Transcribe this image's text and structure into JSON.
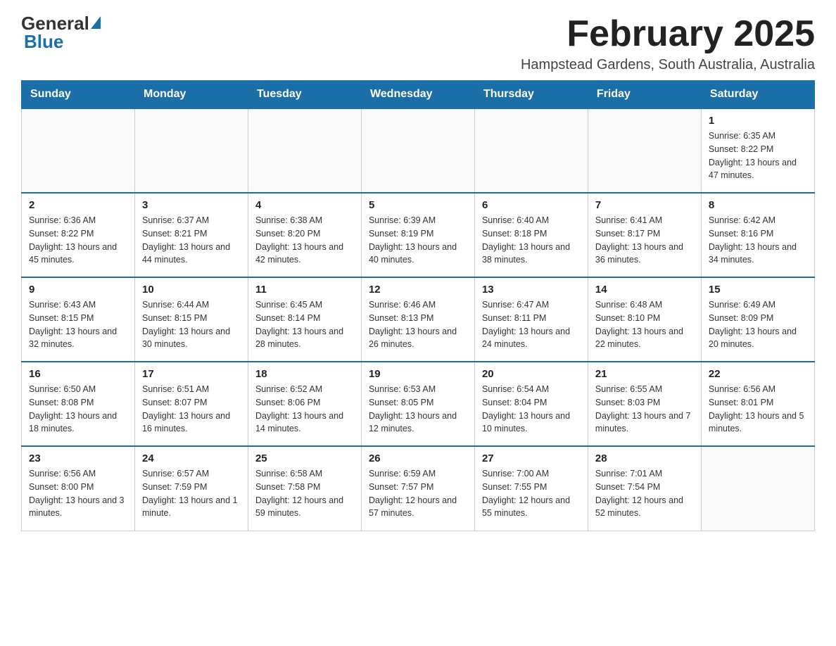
{
  "header": {
    "logo_general": "General",
    "logo_blue": "Blue",
    "title": "February 2025",
    "subtitle": "Hampstead Gardens, South Australia, Australia"
  },
  "weekdays": [
    "Sunday",
    "Monday",
    "Tuesday",
    "Wednesday",
    "Thursday",
    "Friday",
    "Saturday"
  ],
  "weeks": [
    [
      {
        "day": "",
        "info": ""
      },
      {
        "day": "",
        "info": ""
      },
      {
        "day": "",
        "info": ""
      },
      {
        "day": "",
        "info": ""
      },
      {
        "day": "",
        "info": ""
      },
      {
        "day": "",
        "info": ""
      },
      {
        "day": "1",
        "info": "Sunrise: 6:35 AM\nSunset: 8:22 PM\nDaylight: 13 hours and 47 minutes."
      }
    ],
    [
      {
        "day": "2",
        "info": "Sunrise: 6:36 AM\nSunset: 8:22 PM\nDaylight: 13 hours and 45 minutes."
      },
      {
        "day": "3",
        "info": "Sunrise: 6:37 AM\nSunset: 8:21 PM\nDaylight: 13 hours and 44 minutes."
      },
      {
        "day": "4",
        "info": "Sunrise: 6:38 AM\nSunset: 8:20 PM\nDaylight: 13 hours and 42 minutes."
      },
      {
        "day": "5",
        "info": "Sunrise: 6:39 AM\nSunset: 8:19 PM\nDaylight: 13 hours and 40 minutes."
      },
      {
        "day": "6",
        "info": "Sunrise: 6:40 AM\nSunset: 8:18 PM\nDaylight: 13 hours and 38 minutes."
      },
      {
        "day": "7",
        "info": "Sunrise: 6:41 AM\nSunset: 8:17 PM\nDaylight: 13 hours and 36 minutes."
      },
      {
        "day": "8",
        "info": "Sunrise: 6:42 AM\nSunset: 8:16 PM\nDaylight: 13 hours and 34 minutes."
      }
    ],
    [
      {
        "day": "9",
        "info": "Sunrise: 6:43 AM\nSunset: 8:15 PM\nDaylight: 13 hours and 32 minutes."
      },
      {
        "day": "10",
        "info": "Sunrise: 6:44 AM\nSunset: 8:15 PM\nDaylight: 13 hours and 30 minutes."
      },
      {
        "day": "11",
        "info": "Sunrise: 6:45 AM\nSunset: 8:14 PM\nDaylight: 13 hours and 28 minutes."
      },
      {
        "day": "12",
        "info": "Sunrise: 6:46 AM\nSunset: 8:13 PM\nDaylight: 13 hours and 26 minutes."
      },
      {
        "day": "13",
        "info": "Sunrise: 6:47 AM\nSunset: 8:11 PM\nDaylight: 13 hours and 24 minutes."
      },
      {
        "day": "14",
        "info": "Sunrise: 6:48 AM\nSunset: 8:10 PM\nDaylight: 13 hours and 22 minutes."
      },
      {
        "day": "15",
        "info": "Sunrise: 6:49 AM\nSunset: 8:09 PM\nDaylight: 13 hours and 20 minutes."
      }
    ],
    [
      {
        "day": "16",
        "info": "Sunrise: 6:50 AM\nSunset: 8:08 PM\nDaylight: 13 hours and 18 minutes."
      },
      {
        "day": "17",
        "info": "Sunrise: 6:51 AM\nSunset: 8:07 PM\nDaylight: 13 hours and 16 minutes."
      },
      {
        "day": "18",
        "info": "Sunrise: 6:52 AM\nSunset: 8:06 PM\nDaylight: 13 hours and 14 minutes."
      },
      {
        "day": "19",
        "info": "Sunrise: 6:53 AM\nSunset: 8:05 PM\nDaylight: 13 hours and 12 minutes."
      },
      {
        "day": "20",
        "info": "Sunrise: 6:54 AM\nSunset: 8:04 PM\nDaylight: 13 hours and 10 minutes."
      },
      {
        "day": "21",
        "info": "Sunrise: 6:55 AM\nSunset: 8:03 PM\nDaylight: 13 hours and 7 minutes."
      },
      {
        "day": "22",
        "info": "Sunrise: 6:56 AM\nSunset: 8:01 PM\nDaylight: 13 hours and 5 minutes."
      }
    ],
    [
      {
        "day": "23",
        "info": "Sunrise: 6:56 AM\nSunset: 8:00 PM\nDaylight: 13 hours and 3 minutes."
      },
      {
        "day": "24",
        "info": "Sunrise: 6:57 AM\nSunset: 7:59 PM\nDaylight: 13 hours and 1 minute."
      },
      {
        "day": "25",
        "info": "Sunrise: 6:58 AM\nSunset: 7:58 PM\nDaylight: 12 hours and 59 minutes."
      },
      {
        "day": "26",
        "info": "Sunrise: 6:59 AM\nSunset: 7:57 PM\nDaylight: 12 hours and 57 minutes."
      },
      {
        "day": "27",
        "info": "Sunrise: 7:00 AM\nSunset: 7:55 PM\nDaylight: 12 hours and 55 minutes."
      },
      {
        "day": "28",
        "info": "Sunrise: 7:01 AM\nSunset: 7:54 PM\nDaylight: 12 hours and 52 minutes."
      },
      {
        "day": "",
        "info": ""
      }
    ]
  ]
}
